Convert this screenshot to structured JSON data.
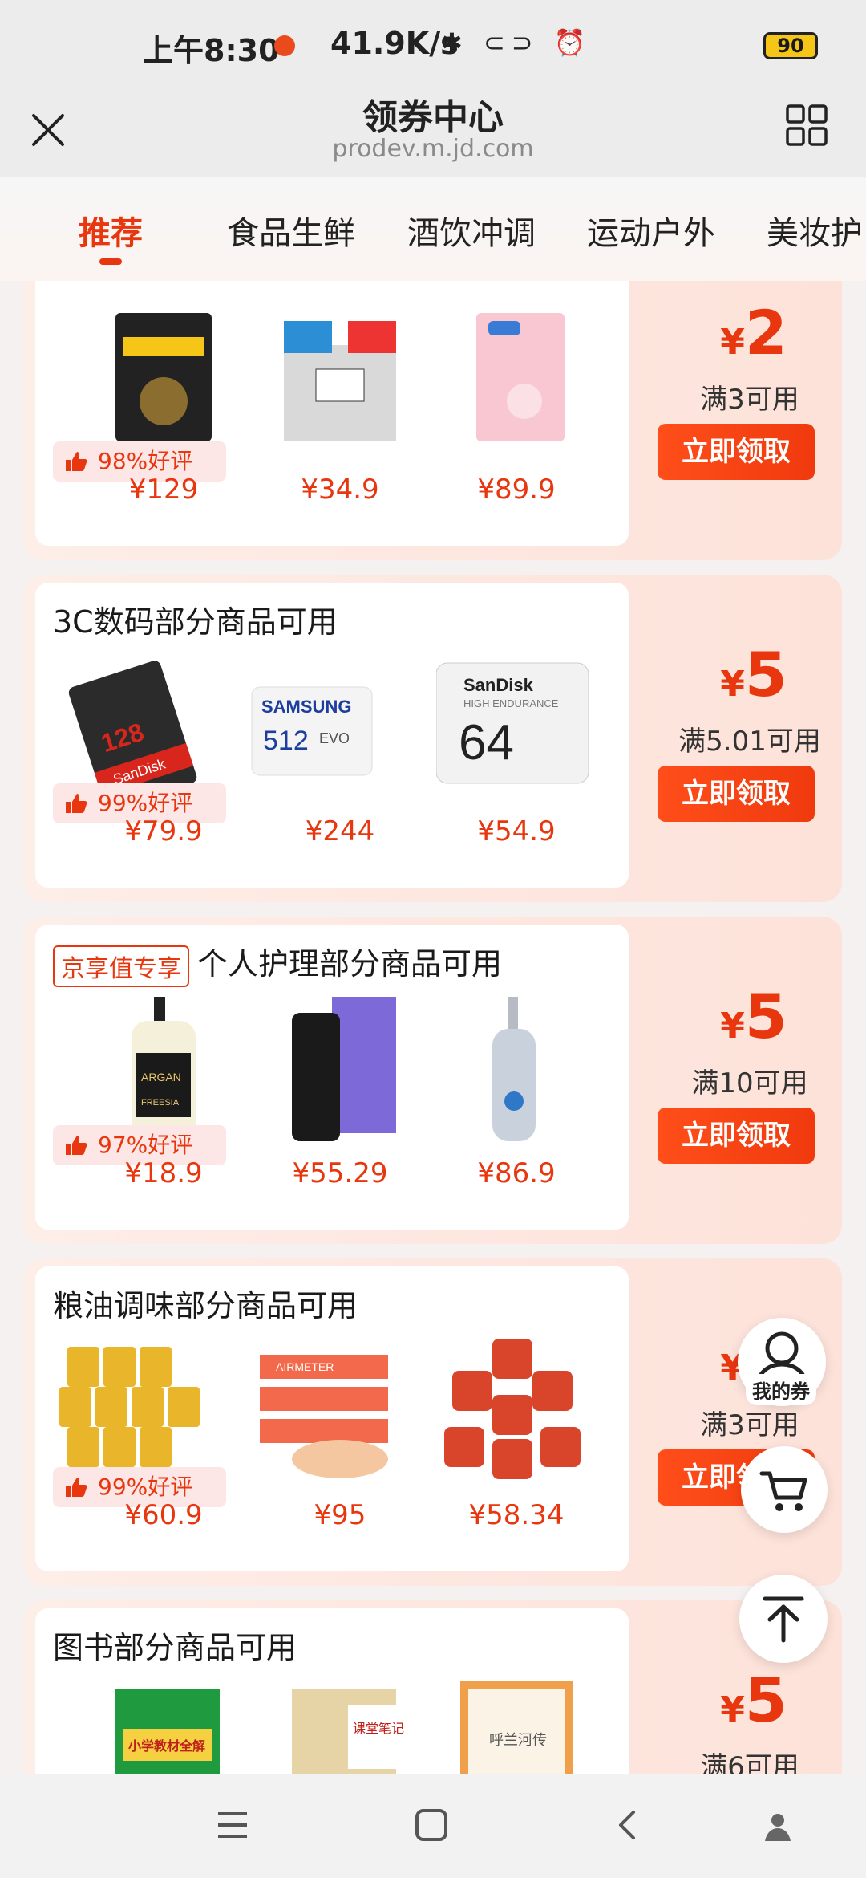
{
  "status_bar": {
    "time": "上午8:30",
    "speed": "41.9K/s",
    "network": "HD 4G HD 4G",
    "battery": "90"
  },
  "header": {
    "title": "领券中心",
    "url": "prodev.m.jd.com"
  },
  "tabs": [
    "推荐",
    "食品生鲜",
    "酒饮冲调",
    "运动户外",
    "美妆护"
  ],
  "cards": [
    {
      "title": "",
      "rating": "98%好评",
      "prices": [
        "¥129",
        "¥34.9",
        "¥89.9"
      ],
      "amount_currency": "¥",
      "amount": "2",
      "condition": "满3可用",
      "button": "立即领取"
    },
    {
      "title": "3C数码部分商品可用",
      "rating": "99%好评",
      "prices": [
        "¥79.9",
        "¥244",
        "¥54.9"
      ],
      "amount_currency": "¥",
      "amount": "5",
      "condition": "满5.01可用",
      "button": "立即领取",
      "product_labels": [
        "128",
        "SanDisk",
        "SAMSUNG",
        "512",
        "EVO",
        "64",
        "HIGH ENDURANCE"
      ]
    },
    {
      "badge": "京享值专享",
      "title": "个人护理部分商品可用",
      "rating": "97%好评",
      "prices": [
        "¥18.9",
        "¥55.29",
        "¥86.9"
      ],
      "amount_currency": "¥",
      "amount": "5",
      "condition": "满10可用",
      "button": "立即领取",
      "product_labels": [
        "ARGAN",
        "FREESIA"
      ]
    },
    {
      "title": "粮油调味部分商品可用",
      "rating": "99%好评",
      "prices": [
        "¥60.9",
        "¥95",
        "¥58.34"
      ],
      "amount_currency": "¥",
      "amount": "2",
      "condition": "满3可用",
      "button": "立即领取",
      "product_labels": [
        "AIRMETER"
      ]
    },
    {
      "title": "图书部分商品可用",
      "amount_currency": "¥",
      "amount": "5",
      "condition": "满6可用",
      "product_labels": [
        "小学教材全解",
        "课堂笔记",
        "呼兰河传"
      ]
    }
  ],
  "floating": {
    "my_coupons": "我的券"
  },
  "colors": {
    "accent": "#e8370f",
    "card_bg": "#fde8e0"
  }
}
